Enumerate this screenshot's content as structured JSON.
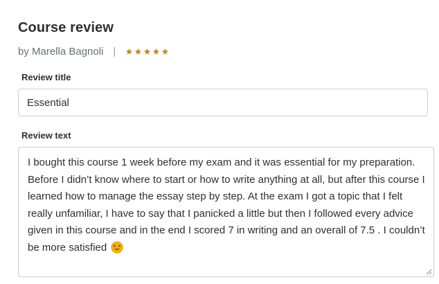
{
  "header": {
    "title": "Course review",
    "author": "by Marella Bagnoli",
    "separator": "|",
    "rating": 5,
    "rating_max": 5,
    "star_icon": "star-icon",
    "star_color": "#c4891a"
  },
  "form": {
    "review_title_label": "Review title",
    "review_title_value": "Essential",
    "review_text_label": "Review text",
    "review_text_value": "I bought this course 1 week before my exam and it was essential for my preparation. Before I didn’t know where to start or how to write anything at all, but after this course I learned how to manage the essay step by step. At the exam I got a topic that I felt really unfamiliar, I have to say that I panicked a little but then I followed every advice given in this course and in the end I scored 7 in writing and an overall of 7.5 . I couldn’t be more satisfied",
    "emoji_icon": "star-struck-emoji-icon"
  },
  "colors": {
    "text_primary": "#2d2f31",
    "text_secondary": "#6a6f73",
    "border": "#c9ccd0"
  }
}
